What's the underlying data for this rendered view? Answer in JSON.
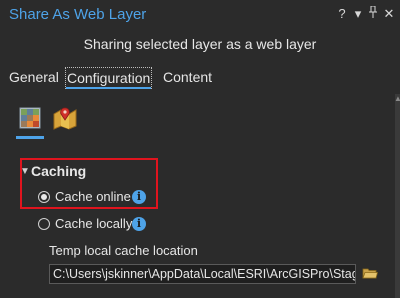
{
  "window": {
    "title": "Share As Web Layer",
    "menu_glyph": "?",
    "dropdown_glyph": "▾",
    "pin_glyph": "ᛘ",
    "close_glyph": "✕"
  },
  "header": {
    "subtitle": "Sharing selected layer as a web layer"
  },
  "tabs": [
    {
      "label": "General",
      "active": false
    },
    {
      "label": "Configuration",
      "active": true
    },
    {
      "label": "Content",
      "active": false
    }
  ],
  "config_icons": [
    {
      "name": "layers-config-icon",
      "selected": true
    },
    {
      "name": "map-config-icon",
      "selected": false
    }
  ],
  "caching": {
    "section_label": "Caching",
    "options": [
      {
        "label": "Cache online",
        "selected": true
      },
      {
        "label": "Cache locally",
        "selected": false
      }
    ],
    "temp_location_label": "Temp local cache location",
    "temp_location_value": "C:\\Users\\jskinner\\AppData\\Local\\ESRI\\ArcGISPro\\Staging"
  },
  "colors": {
    "background": "#2b2b2b",
    "accent": "#4ea3e8",
    "highlight_box": "#e0141e"
  }
}
